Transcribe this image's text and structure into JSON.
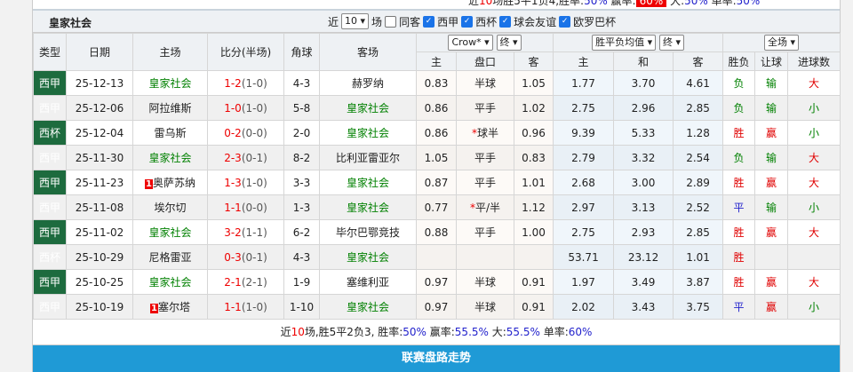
{
  "top_summary": {
    "prefix": "近",
    "n": "10",
    "mid": "场胜5平1负4,胜率:",
    "win": "50%",
    "ying_label": " 赢率:",
    "ying": "60%",
    "da_label": " 大:",
    "da": "50%",
    "dan_label": " 单率:",
    "dan": "50%"
  },
  "filter": {
    "team": "皇家社会",
    "near": "近",
    "count": "10",
    "chang": "场",
    "same_host": "同客",
    "leagues": [
      "西甲",
      "西杯",
      "球会友谊",
      "欧罗巴杯"
    ]
  },
  "headers": {
    "type": "类型",
    "date": "日期",
    "home": "主场",
    "score": "比分(半场)",
    "corner": "角球",
    "away": "客场",
    "company": "Crow*",
    "final1": "终",
    "odds_mode": "胜平负均值",
    "final2": "终",
    "scope": "全场",
    "h_home": "主",
    "h_line": "盘口",
    "h_away": "客",
    "e_home": "主",
    "e_draw": "和",
    "e_away": "客",
    "res": "胜负",
    "hcp": "让球",
    "goals": "进球数"
  },
  "rows": [
    {
      "type": "西甲",
      "date": "25-12-13",
      "home": "皇家社会",
      "home_rank": "",
      "score": "1-2",
      "half": "(1-0)",
      "corner": "4-3",
      "away": "赫罗纳",
      "away_rank": "",
      "ah": "0.83",
      "line": "半球",
      "star": "",
      "aa": "1.05",
      "eh": "1.77",
      "ed": "3.70",
      "ea": "4.61",
      "res": "负",
      "hcp": "输",
      "goals": "大",
      "focus": "home"
    },
    {
      "type": "西甲",
      "date": "25-12-06",
      "home": "阿拉维斯",
      "home_rank": "",
      "score": "1-0",
      "half": "(1-0)",
      "corner": "5-8",
      "away": "皇家社会",
      "ah": "0.86",
      "line": "平手",
      "star": "",
      "aa": "1.02",
      "eh": "2.75",
      "ed": "2.96",
      "ea": "2.85",
      "res": "负",
      "hcp": "输",
      "goals": "小",
      "focus": "away"
    },
    {
      "type": "西杯",
      "date": "25-12-04",
      "home": "雷乌斯",
      "home_rank": "",
      "score": "0-2",
      "half": "(0-0)",
      "corner": "2-0",
      "away": "皇家社会",
      "ah": "0.86",
      "line": "球半",
      "star": "*",
      "aa": "0.96",
      "eh": "9.39",
      "ed": "5.33",
      "ea": "1.28",
      "res": "胜",
      "hcp": "赢",
      "goals": "小",
      "focus": "away"
    },
    {
      "type": "西甲",
      "date": "25-11-30",
      "home": "皇家社会",
      "home_rank": "",
      "score": "2-3",
      "half": "(0-1)",
      "corner": "8-2",
      "away": "比利亚雷亚尔",
      "ah": "1.05",
      "line": "平手",
      "star": "",
      "aa": "0.83",
      "eh": "2.79",
      "ed": "3.32",
      "ea": "2.54",
      "res": "负",
      "hcp": "输",
      "goals": "大",
      "focus": "home"
    },
    {
      "type": "西甲",
      "date": "25-11-23",
      "home": "奥萨苏纳",
      "home_rank": "1",
      "score": "1-3",
      "half": "(1-0)",
      "corner": "3-3",
      "away": "皇家社会",
      "ah": "0.87",
      "line": "平手",
      "star": "",
      "aa": "1.01",
      "eh": "2.68",
      "ed": "3.00",
      "ea": "2.89",
      "res": "胜",
      "hcp": "赢",
      "goals": "大",
      "focus": "away"
    },
    {
      "type": "西甲",
      "date": "25-11-08",
      "home": "埃尔切",
      "home_rank": "",
      "score": "1-1",
      "half": "(0-0)",
      "corner": "1-3",
      "away": "皇家社会",
      "ah": "0.77",
      "line": "平/半",
      "star": "*",
      "aa": "1.12",
      "eh": "2.97",
      "ed": "3.13",
      "ea": "2.52",
      "res": "平",
      "hcp": "输",
      "goals": "小",
      "focus": "away"
    },
    {
      "type": "西甲",
      "date": "25-11-02",
      "home": "皇家社会",
      "home_rank": "",
      "score": "3-2",
      "half": "(1-1)",
      "corner": "6-2",
      "away": "毕尔巴鄂竞技",
      "ah": "0.88",
      "line": "平手",
      "star": "",
      "aa": "1.00",
      "eh": "2.75",
      "ed": "2.93",
      "ea": "2.85",
      "res": "胜",
      "hcp": "赢",
      "goals": "大",
      "focus": "home"
    },
    {
      "type": "西杯",
      "date": "25-10-29",
      "home": "尼格雷亚",
      "home_rank": "",
      "score": "0-3",
      "half": "(0-1)",
      "corner": "4-3",
      "away": "皇家社会",
      "ah": "",
      "line": "",
      "star": "",
      "aa": "",
      "eh": "53.71",
      "ed": "23.12",
      "ea": "1.01",
      "res": "胜",
      "hcp": "",
      "goals": "",
      "focus": "away"
    },
    {
      "type": "西甲",
      "date": "25-10-25",
      "home": "皇家社会",
      "home_rank": "",
      "score": "2-1",
      "half": "(2-1)",
      "corner": "1-9",
      "away": "塞维利亚",
      "ah": "0.97",
      "line": "半球",
      "star": "",
      "aa": "0.91",
      "eh": "1.97",
      "ed": "3.49",
      "ea": "3.87",
      "res": "胜",
      "hcp": "赢",
      "goals": "大",
      "focus": "home"
    },
    {
      "type": "西甲",
      "date": "25-10-19",
      "home": "塞尔塔",
      "home_rank": "1",
      "score": "1-1",
      "half": "(1-0)",
      "corner": "1-10",
      "away": "皇家社会",
      "ah": "0.97",
      "line": "半球",
      "star": "",
      "aa": "0.91",
      "eh": "2.02",
      "ed": "3.43",
      "ea": "3.75",
      "res": "平",
      "hcp": "赢",
      "goals": "小",
      "focus": "away"
    }
  ],
  "summary": {
    "p1": "近",
    "n": "10",
    "p2": "场,胜5平2负3, 胜率:",
    "win": "50%",
    "p3": " 赢率:",
    "ying": "55.5%",
    "p4": " 大:",
    "da": "55.5%",
    "p5": " 单率:",
    "dan": "60%"
  },
  "section_title": "联赛盘路走势",
  "colors": {
    "win": "#e00000",
    "lose": "#008000",
    "draw": "#2222cc",
    "type_bg": "#1d6b3e",
    "bar": "#1f9ad6"
  }
}
